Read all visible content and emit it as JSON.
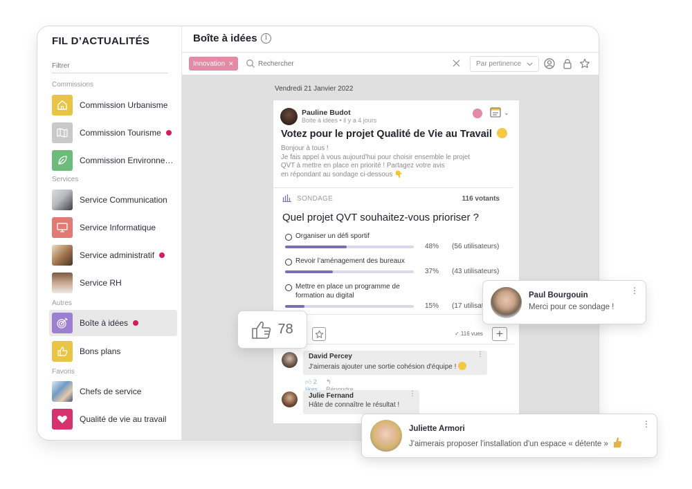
{
  "sidebar": {
    "title": "FIL D’ACTUALITÉS",
    "filter_placeholder": "Filtrer",
    "sections": {
      "commissions": "Commissions",
      "services": "Services",
      "autres": "Autres",
      "favoris": "Favoris"
    },
    "items": [
      {
        "label": "Commission Urbanisme",
        "icon": "house-icon",
        "color": "#e8c547",
        "unread": false
      },
      {
        "label": "Commission Tourisme",
        "icon": "map-icon",
        "color": "#c9c9c9",
        "unread": true
      },
      {
        "label": "Commission Environne…",
        "icon": "leaf-icon",
        "color": "#6dbb7a",
        "unread": false
      },
      {
        "label": "Service Communication",
        "icon": "photo-communication",
        "color": "#8a8f98",
        "unread": false
      },
      {
        "label": "Service Informatique",
        "icon": "monitor-icon",
        "color": "#e07a72",
        "unread": false
      },
      {
        "label": "Service administratif",
        "icon": "photo-administratif",
        "color": "#a57a52",
        "unread": true
      },
      {
        "label": "Service RH",
        "icon": "photo-rh",
        "color": "#9b7f6a",
        "unread": false
      },
      {
        "label": "Boîte à idées",
        "icon": "target-icon",
        "color": "#9b7fd1",
        "unread": true,
        "active": true
      },
      {
        "label": "Bons plans",
        "icon": "thumbs-up-icon",
        "color": "#e8c547",
        "unread": false
      },
      {
        "label": "Chefs de service",
        "icon": "photo-chefs",
        "color": "#6f9bc4",
        "unread": false
      },
      {
        "label": "Qualité de vie au travail",
        "icon": "heart-icon",
        "color": "#d6336c",
        "unread": false
      }
    ],
    "unread_color": "#d81b60"
  },
  "header": {
    "title": "Boîte à idées",
    "info_icon": "i"
  },
  "toolbar": {
    "chip_label": "Innovation",
    "chip_close": "✕",
    "search_placeholder": "Rechercher",
    "sort_value": "Par pertinence",
    "sort_chevron": "⌄"
  },
  "feed": {
    "date": "Vendredi 21 Janvier 2022",
    "post": {
      "author": "Pauline Budot",
      "meta": "Boite à idées • il y a 4 jours",
      "title": "Votez pour le projet Qualité de Vie au Travail",
      "body_lines": [
        "Bonjour à tous !",
        "Je fais appel à vous aujourd'hui pour choisir ensemble le projet",
        "QVT à mettre en place en priorité ! Partagez votre avis",
        "en répondant au sondage ci-dessous 👇"
      ],
      "poll": {
        "label": "SONDAGE",
        "voters": "116 votants",
        "question": "Quel projet QVT souhaitez-vous prioriser ?",
        "options": [
          {
            "label": "Organiser un défi sportif",
            "percent": 48,
            "percent_label": "48%",
            "users": "(56 utilisateurs)"
          },
          {
            "label": "Revoir l’aménagement des bureaux",
            "percent": 37,
            "percent_label": "37%",
            "users": "(43 utilisateurs)"
          },
          {
            "label": "Mettre en place un programme de formation au digital",
            "percent": 15,
            "percent_label": "15%",
            "users": "(17 utilisateurs)"
          }
        ]
      },
      "views": "✓ 116 vues",
      "likes": "78",
      "comments": [
        {
          "author": "David Percey",
          "text": "J'aimerais ajouter une sortie cohésion d'équipe !",
          "likes": "2 likes",
          "reply": "Répondre"
        },
        {
          "author": "Julie Fernand",
          "text": "Hâte de connaître le résultat !"
        }
      ]
    }
  },
  "floating_comments": [
    {
      "author": "Paul Bourgouin",
      "text": "Merci pour ce sondage !"
    },
    {
      "author": "Juliette Armori",
      "text": "J'aimerais proposer l'installation d'un espace « détente »"
    }
  ]
}
